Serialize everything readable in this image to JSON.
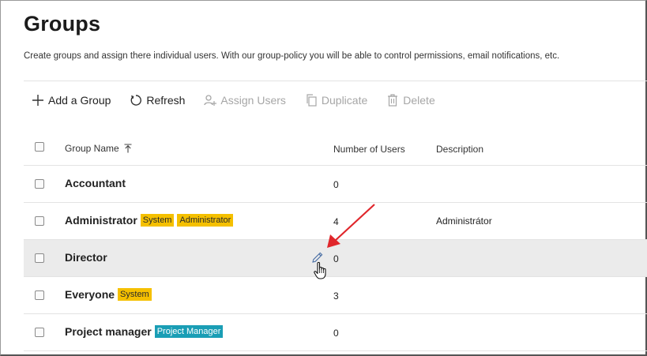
{
  "page": {
    "title": "Groups",
    "subtitle": "Create groups and assign there individual users. With our group-policy you will be able to control permissions, email notifications, etc."
  },
  "toolbar": {
    "add_group": "Add a Group",
    "refresh": "Refresh",
    "assign_users": "Assign Users",
    "duplicate": "Duplicate",
    "delete": "Delete"
  },
  "table": {
    "headers": {
      "name": "Group Name",
      "users": "Number of Users",
      "description": "Description"
    },
    "rows": [
      {
        "name": "Accountant",
        "badges": [],
        "users": "0",
        "description": ""
      },
      {
        "name": "Administrator",
        "badges": [
          {
            "text": "System",
            "color": "#f5c000"
          },
          {
            "text": "Administrator",
            "color": "#f5c000"
          }
        ],
        "users": "4",
        "description": "Administrátor"
      },
      {
        "name": "Director",
        "badges": [],
        "users": "0",
        "description": ""
      },
      {
        "name": "Everyone",
        "badges": [
          {
            "text": "System",
            "color": "#f5c000"
          }
        ],
        "users": "3",
        "description": ""
      },
      {
        "name": "Project manager",
        "badges": [
          {
            "text": "Project Manager",
            "color": "#1a9eb5"
          }
        ],
        "users": "0",
        "description": ""
      }
    ]
  },
  "colors": {
    "badge_yellow": "#f5c000",
    "badge_teal": "#1a9eb5",
    "annotation_arrow": "#e0262b",
    "hover_row": "#ebebeb"
  }
}
